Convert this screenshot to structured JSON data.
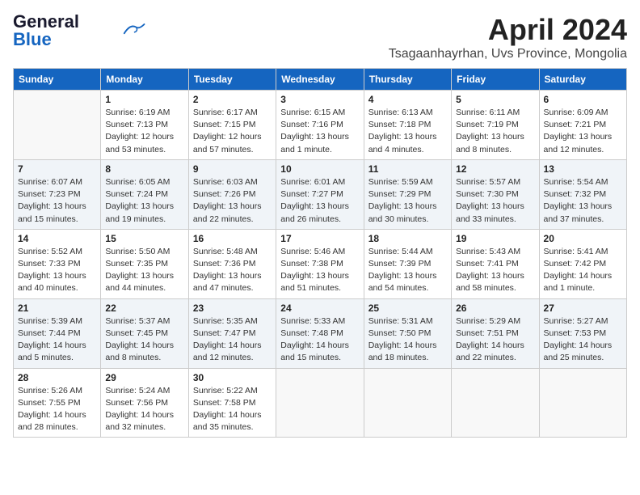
{
  "header": {
    "logo_line1": "General",
    "logo_line2": "Blue",
    "month": "April 2024",
    "location": "Tsagaanhayrhan, Uvs Province, Mongolia"
  },
  "weekdays": [
    "Sunday",
    "Monday",
    "Tuesday",
    "Wednesday",
    "Thursday",
    "Friday",
    "Saturday"
  ],
  "weeks": [
    [
      {
        "day": "",
        "info": ""
      },
      {
        "day": "1",
        "info": "Sunrise: 6:19 AM\nSunset: 7:13 PM\nDaylight: 12 hours\nand 53 minutes."
      },
      {
        "day": "2",
        "info": "Sunrise: 6:17 AM\nSunset: 7:15 PM\nDaylight: 12 hours\nand 57 minutes."
      },
      {
        "day": "3",
        "info": "Sunrise: 6:15 AM\nSunset: 7:16 PM\nDaylight: 13 hours\nand 1 minute."
      },
      {
        "day": "4",
        "info": "Sunrise: 6:13 AM\nSunset: 7:18 PM\nDaylight: 13 hours\nand 4 minutes."
      },
      {
        "day": "5",
        "info": "Sunrise: 6:11 AM\nSunset: 7:19 PM\nDaylight: 13 hours\nand 8 minutes."
      },
      {
        "day": "6",
        "info": "Sunrise: 6:09 AM\nSunset: 7:21 PM\nDaylight: 13 hours\nand 12 minutes."
      }
    ],
    [
      {
        "day": "7",
        "info": "Sunrise: 6:07 AM\nSunset: 7:23 PM\nDaylight: 13 hours\nand 15 minutes."
      },
      {
        "day": "8",
        "info": "Sunrise: 6:05 AM\nSunset: 7:24 PM\nDaylight: 13 hours\nand 19 minutes."
      },
      {
        "day": "9",
        "info": "Sunrise: 6:03 AM\nSunset: 7:26 PM\nDaylight: 13 hours\nand 22 minutes."
      },
      {
        "day": "10",
        "info": "Sunrise: 6:01 AM\nSunset: 7:27 PM\nDaylight: 13 hours\nand 26 minutes."
      },
      {
        "day": "11",
        "info": "Sunrise: 5:59 AM\nSunset: 7:29 PM\nDaylight: 13 hours\nand 30 minutes."
      },
      {
        "day": "12",
        "info": "Sunrise: 5:57 AM\nSunset: 7:30 PM\nDaylight: 13 hours\nand 33 minutes."
      },
      {
        "day": "13",
        "info": "Sunrise: 5:54 AM\nSunset: 7:32 PM\nDaylight: 13 hours\nand 37 minutes."
      }
    ],
    [
      {
        "day": "14",
        "info": "Sunrise: 5:52 AM\nSunset: 7:33 PM\nDaylight: 13 hours\nand 40 minutes."
      },
      {
        "day": "15",
        "info": "Sunrise: 5:50 AM\nSunset: 7:35 PM\nDaylight: 13 hours\nand 44 minutes."
      },
      {
        "day": "16",
        "info": "Sunrise: 5:48 AM\nSunset: 7:36 PM\nDaylight: 13 hours\nand 47 minutes."
      },
      {
        "day": "17",
        "info": "Sunrise: 5:46 AM\nSunset: 7:38 PM\nDaylight: 13 hours\nand 51 minutes."
      },
      {
        "day": "18",
        "info": "Sunrise: 5:44 AM\nSunset: 7:39 PM\nDaylight: 13 hours\nand 54 minutes."
      },
      {
        "day": "19",
        "info": "Sunrise: 5:43 AM\nSunset: 7:41 PM\nDaylight: 13 hours\nand 58 minutes."
      },
      {
        "day": "20",
        "info": "Sunrise: 5:41 AM\nSunset: 7:42 PM\nDaylight: 14 hours\nand 1 minute."
      }
    ],
    [
      {
        "day": "21",
        "info": "Sunrise: 5:39 AM\nSunset: 7:44 PM\nDaylight: 14 hours\nand 5 minutes."
      },
      {
        "day": "22",
        "info": "Sunrise: 5:37 AM\nSunset: 7:45 PM\nDaylight: 14 hours\nand 8 minutes."
      },
      {
        "day": "23",
        "info": "Sunrise: 5:35 AM\nSunset: 7:47 PM\nDaylight: 14 hours\nand 12 minutes."
      },
      {
        "day": "24",
        "info": "Sunrise: 5:33 AM\nSunset: 7:48 PM\nDaylight: 14 hours\nand 15 minutes."
      },
      {
        "day": "25",
        "info": "Sunrise: 5:31 AM\nSunset: 7:50 PM\nDaylight: 14 hours\nand 18 minutes."
      },
      {
        "day": "26",
        "info": "Sunrise: 5:29 AM\nSunset: 7:51 PM\nDaylight: 14 hours\nand 22 minutes."
      },
      {
        "day": "27",
        "info": "Sunrise: 5:27 AM\nSunset: 7:53 PM\nDaylight: 14 hours\nand 25 minutes."
      }
    ],
    [
      {
        "day": "28",
        "info": "Sunrise: 5:26 AM\nSunset: 7:55 PM\nDaylight: 14 hours\nand 28 minutes."
      },
      {
        "day": "29",
        "info": "Sunrise: 5:24 AM\nSunset: 7:56 PM\nDaylight: 14 hours\nand 32 minutes."
      },
      {
        "day": "30",
        "info": "Sunrise: 5:22 AM\nSunset: 7:58 PM\nDaylight: 14 hours\nand 35 minutes."
      },
      {
        "day": "",
        "info": ""
      },
      {
        "day": "",
        "info": ""
      },
      {
        "day": "",
        "info": ""
      },
      {
        "day": "",
        "info": ""
      }
    ]
  ]
}
